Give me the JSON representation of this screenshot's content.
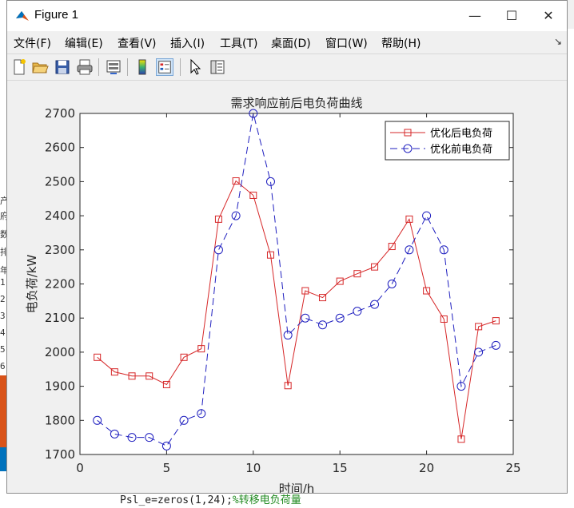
{
  "window": {
    "title": "Figure 1"
  },
  "menu": [
    "文件(F)",
    "编辑(E)",
    "查看(V)",
    "插入(I)",
    "工具(T)",
    "桌面(D)",
    "窗口(W)",
    "帮助(H)"
  ],
  "toolbar": {
    "icons": [
      "new-figure-icon",
      "open-file-icon",
      "save-icon",
      "print-icon",
      "link-plot-icon",
      "colorbar-icon",
      "legend-icon",
      "pointer-icon",
      "property-editor-icon"
    ]
  },
  "background": {
    "code_text": "Psl_e=zeros(1,24);",
    "code_comment": "%转移电负荷量",
    "left_fragments": [
      "产",
      "府",
      "数",
      "排",
      "年",
      "1",
      "2",
      "3",
      "4",
      "5",
      "6"
    ]
  },
  "chart_data": {
    "type": "line",
    "title": "需求响应前后电负荷曲线",
    "xlabel": "时间/h",
    "ylabel": "电负荷/kW",
    "xlim": [
      0,
      25
    ],
    "ylim": [
      1700,
      2700
    ],
    "xticks": [
      0,
      5,
      10,
      15,
      20,
      25
    ],
    "yticks": [
      1700,
      1800,
      1900,
      2000,
      2100,
      2200,
      2300,
      2400,
      2500,
      2600,
      2700
    ],
    "legend_position": "top-right",
    "x": [
      1,
      2,
      3,
      4,
      5,
      6,
      7,
      8,
      9,
      10,
      11,
      12,
      13,
      14,
      15,
      16,
      17,
      18,
      19,
      20,
      21,
      22,
      23,
      24
    ],
    "series": [
      {
        "name": "优化后电负荷",
        "color": "#d62728",
        "line": "solid",
        "marker": "square",
        "values": [
          1985,
          1942,
          1930,
          1930,
          1905,
          1985,
          2010,
          2390,
          2502,
          2460,
          2285,
          1902,
          2180,
          2160,
          2208,
          2230,
          2250,
          2310,
          2390,
          2180,
          2097,
          1745,
          2075,
          2092
        ]
      },
      {
        "name": "优化前电负荷",
        "color": "#1f1fbf",
        "line": "dashed",
        "marker": "circle",
        "values": [
          1800,
          1760,
          1750,
          1750,
          1725,
          1800,
          1820,
          2300,
          2400,
          2700,
          2500,
          2050,
          2100,
          2080,
          2100,
          2120,
          2140,
          2200,
          2300,
          2400,
          2300,
          1900,
          2000,
          2020
        ]
      }
    ]
  }
}
